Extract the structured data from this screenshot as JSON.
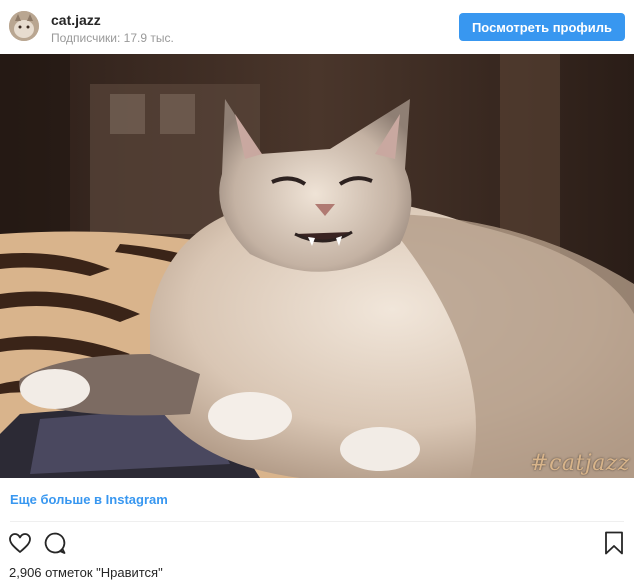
{
  "header": {
    "username": "cat.jazz",
    "followers": "Подписчики: 17.9 тыс.",
    "profile_button": "Посмотреть профиль"
  },
  "photo": {
    "hashtag": "#catjazz"
  },
  "more_link": "Еще больше в Instagram",
  "actions": {
    "icons": [
      "heart-icon",
      "comment-icon",
      "bookmark-icon"
    ]
  },
  "likes_text": "2,906 отметок \"Нравится\"",
  "colors": {
    "accent": "#3897f0",
    "text": "#262626",
    "muted": "#999999"
  }
}
